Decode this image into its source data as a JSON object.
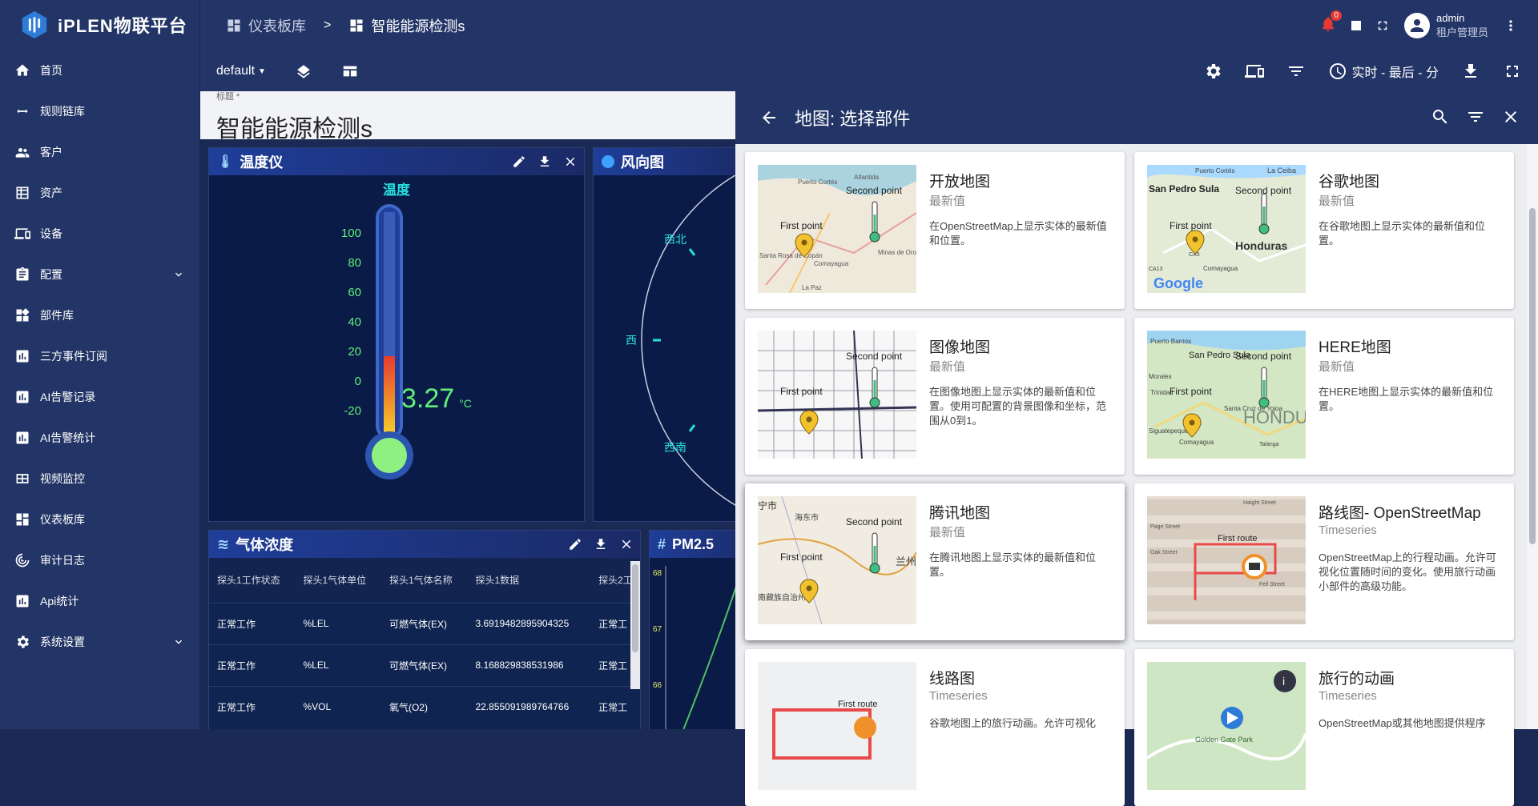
{
  "app": {
    "logo_text": "iPLEN物联平台"
  },
  "sidebar": {
    "items": [
      {
        "label": "首页",
        "icon": "home-icon"
      },
      {
        "label": "规则链库",
        "icon": "rule-chain-icon"
      },
      {
        "label": "客户",
        "icon": "customers-icon"
      },
      {
        "label": "资产",
        "icon": "assets-icon"
      },
      {
        "label": "设备",
        "icon": "devices-icon"
      },
      {
        "label": "配置",
        "icon": "config-icon",
        "expandable": true
      },
      {
        "label": "部件库",
        "icon": "widgets-icon"
      },
      {
        "label": "三方事件订阅",
        "icon": "chart-icon"
      },
      {
        "label": "AI告警记录",
        "icon": "chart-icon"
      },
      {
        "label": "AI告警统计",
        "icon": "chart-icon"
      },
      {
        "label": "视频监控",
        "icon": "video-icon"
      },
      {
        "label": "仪表板库",
        "icon": "dashboard-icon"
      },
      {
        "label": "审计日志",
        "icon": "audit-icon"
      },
      {
        "label": "Api统计",
        "icon": "chart-icon"
      },
      {
        "label": "系统设置",
        "icon": "settings-icon",
        "expandable": true
      }
    ]
  },
  "header": {
    "breadcrumb_1": "仪表板库",
    "breadcrumb_sep": ">",
    "breadcrumb_2": "智能能源检测s",
    "notif_count": "0",
    "user_name": "admin",
    "user_role": "租户管理员"
  },
  "toolbar": {
    "state_select": "default",
    "timewindow": "实时 - 最后 - 分"
  },
  "dashboard": {
    "title_label": "标题 *",
    "title_value": "智能能源检测s",
    "thermo": {
      "title": "温度仪",
      "chart_title": "温度",
      "ticks": [
        "100",
        "80",
        "60",
        "40",
        "20",
        "0",
        "-20"
      ],
      "value": "3.27",
      "unit": "°C"
    },
    "wind": {
      "title": "风向图",
      "labels": {
        "nw": "西北",
        "w": "西",
        "sw": "西南"
      }
    },
    "gas": {
      "title": "气体浓度",
      "headers": [
        "探头1工作状态",
        "探头1气体单位",
        "探头1气体名称",
        "探头1数据",
        "探头2工"
      ],
      "rows": [
        [
          "正常工作",
          "%LEL",
          "可燃气体(EX)",
          "3.6919482895904325",
          "正常工"
        ],
        [
          "正常工作",
          "%LEL",
          "可燃气体(EX)",
          "8.168829838531986",
          "正常工"
        ],
        [
          "正常工作",
          "%VOL",
          "氧气(O2)",
          "22.855091989764766",
          "正常工"
        ]
      ]
    },
    "pm": {
      "title": "PM2.5",
      "y_ticks": [
        "68",
        "67",
        "66"
      ]
    }
  },
  "panel": {
    "title": "地图: 选择部件",
    "cards": [
      {
        "name": "开放地图",
        "type": "最新值",
        "desc": "在OpenStreetMap上显示实体的最新值和位置。",
        "thumb": "osm-map"
      },
      {
        "name": "谷歌地图",
        "type": "最新值",
        "desc": "在谷歌地图上显示实体的最新值和位置。",
        "thumb": "google-map"
      },
      {
        "name": "图像地图",
        "type": "最新值",
        "desc": "在图像地图上显示实体的最新值和位置。使用可配置的背景图像和坐标，范围从0到1。",
        "thumb": "image-map"
      },
      {
        "name": "HERE地图",
        "type": "最新值",
        "desc": "在HERE地图上显示实体的最新值和位置。",
        "thumb": "here-map"
      },
      {
        "name": "腾讯地图",
        "type": "最新值",
        "desc": "在腾讯地图上显示实体的最新值和位置。",
        "thumb": "tencent-map"
      },
      {
        "name": "路线图- OpenStreetMap",
        "type": "Timeseries",
        "desc": "OpenStreetMap上的行程动画。允许可视化位置随时间的变化。使用旅行动画小部件的高级功能。",
        "thumb": "route-osm"
      },
      {
        "name": "线路图",
        "type": "Timeseries",
        "desc": "谷歌地图上的旅行动画。允许可视化",
        "thumb": "route-google"
      },
      {
        "name": "旅行的动画",
        "type": "Timeseries",
        "desc": "OpenStreetMap或其他地图提供程序",
        "thumb": "trip-animation"
      }
    ],
    "thumb_labels": {
      "second_point": "Second point",
      "first_point": "First point",
      "first_route": "First route",
      "osm_places": [
        "Puerto Cortés",
        "Atlantida",
        "Santa Rosa de Copán",
        "Comayagua",
        "La Paz",
        "Minas de Oro"
      ],
      "google_places": [
        "Puerto Cortés",
        "La Ceiba",
        "San Pedro Sula",
        "Honduras",
        "Comayagua",
        "CA5",
        "CA13"
      ],
      "google_logo": "Google",
      "here_places": [
        "Puerto Barrios",
        "San Pedro Sula",
        "Morales",
        "Trinidad",
        "Santa Cruz de Yojoa",
        "Siguatepeque",
        "Comayagua",
        "Talanga"
      ],
      "here_country": "HONDU",
      "tencent_places": [
        "宁市",
        "海东市",
        "兰州",
        "南藏族自治州"
      ],
      "route_streets": [
        "Haight Street",
        "Page Street",
        "Oak Street",
        "Fell Street"
      ],
      "trip_park": "Golden Gate Park"
    }
  }
}
